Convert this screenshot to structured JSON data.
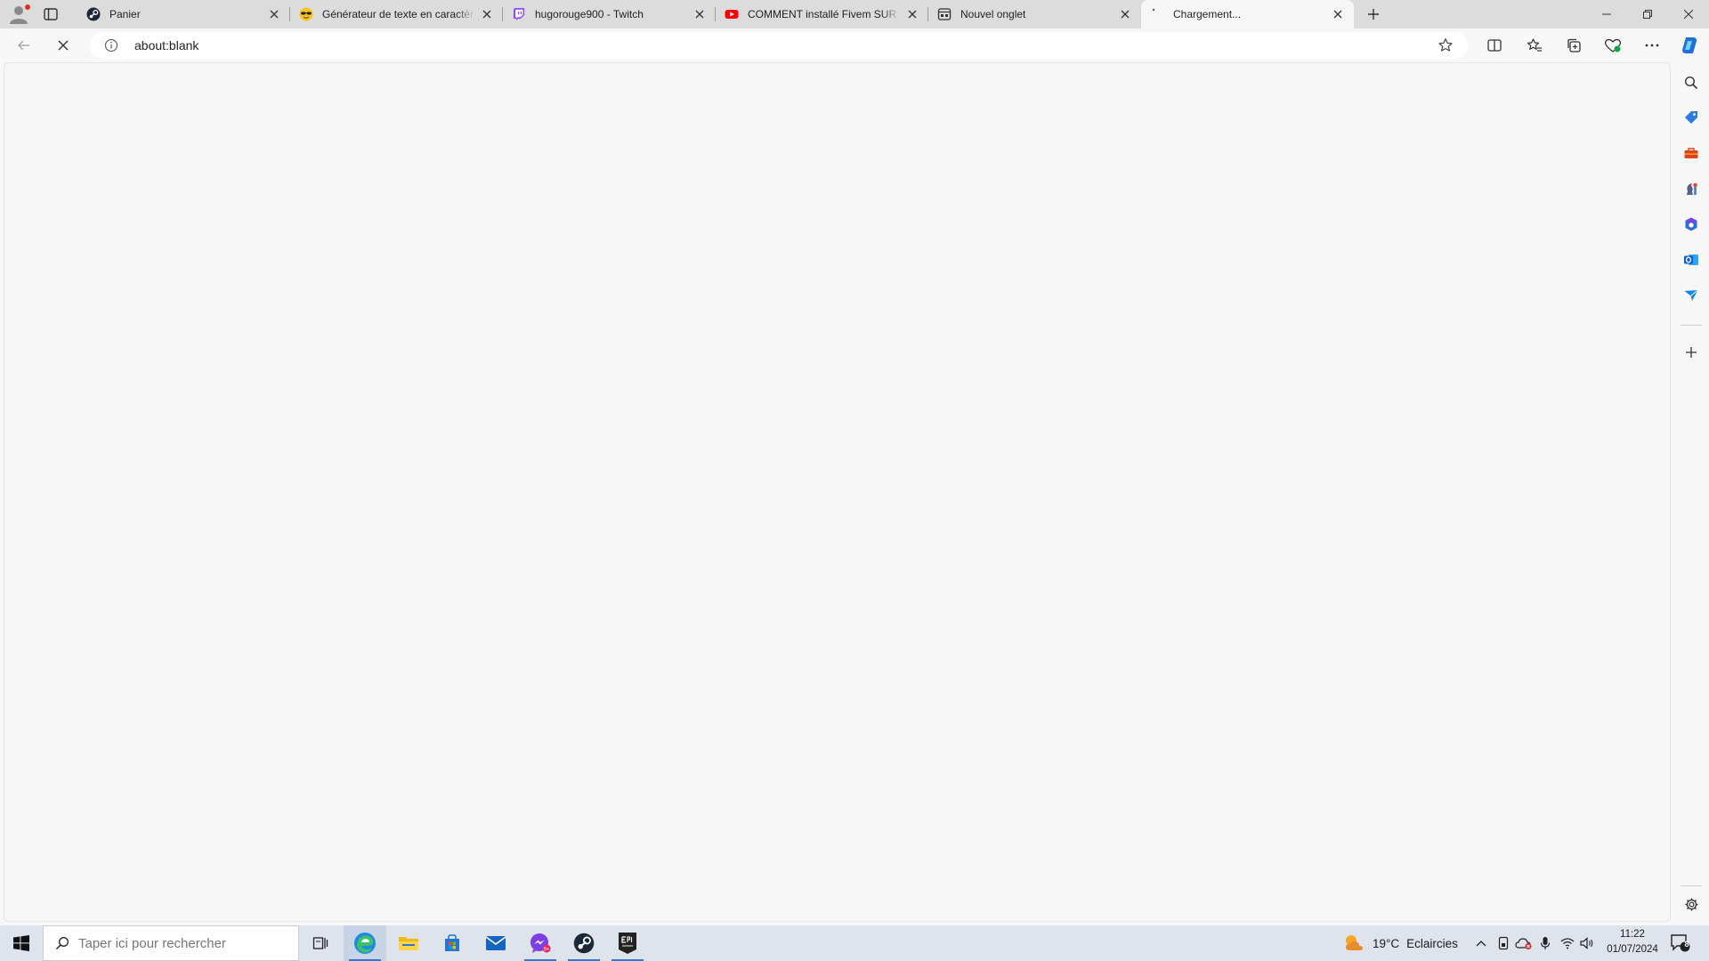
{
  "tabs": [
    {
      "title": "Panier",
      "icon": "steam-icon"
    },
    {
      "title": "Générateur de texte en caractères",
      "icon": "sunglasses-emoji-icon"
    },
    {
      "title": "hugorouge900 - Twitch",
      "icon": "twitch-icon"
    },
    {
      "title": "COMMENT installé Fivem SUR PC",
      "icon": "youtube-icon"
    },
    {
      "title": "Nouvel onglet",
      "icon": "new-tab-page-icon"
    },
    {
      "title": "Chargement...",
      "icon": "loading-icon",
      "active": true
    }
  ],
  "address": {
    "url": "about:blank"
  },
  "taskbar": {
    "search_placeholder": "Taper ici pour rechercher",
    "weather": {
      "temp": "19°C",
      "condition": "Eclaircies"
    },
    "clock": {
      "time": "11:22",
      "date": "01/07/2024"
    },
    "notifications": "8"
  },
  "colors": {
    "accent": "#2a7ad8",
    "tabstrip": "#dcdcdc",
    "page": "#f7f7f7",
    "taskbar": "#dfe3ec"
  }
}
